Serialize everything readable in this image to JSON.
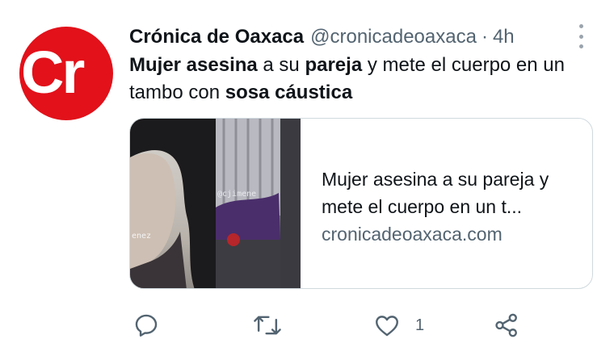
{
  "author": {
    "name": "Crónica de Oaxaca",
    "handle": "@cronicadeoaxaca",
    "separator": "·",
    "time": "4h",
    "avatar_text": "Cr"
  },
  "tweet": {
    "segments": [
      {
        "text": "Mujer asesina",
        "bold": true
      },
      {
        "text": " a su ",
        "bold": false
      },
      {
        "text": "pareja",
        "bold": true
      },
      {
        "text": " y mete el cuerpo en un tambo con ",
        "bold": false
      },
      {
        "text": "sosa cáustica",
        "bold": true
      }
    ]
  },
  "card": {
    "title": "Mujer asesina a su pareja y mete el cuerpo en un t...",
    "domain": "cronicadeoaxaca.com",
    "watermark_left": "enez",
    "watermark_right": "@cjimene"
  },
  "actions": {
    "reply_icon": "reply-icon",
    "retweet_icon": "retweet-icon",
    "like_icon": "heart-icon",
    "like_count": "1",
    "share_icon": "share-icon"
  },
  "colors": {
    "brand_red": "#e2111a",
    "text": "#0f1419",
    "secondary": "#536471",
    "border": "#cfd9de"
  }
}
